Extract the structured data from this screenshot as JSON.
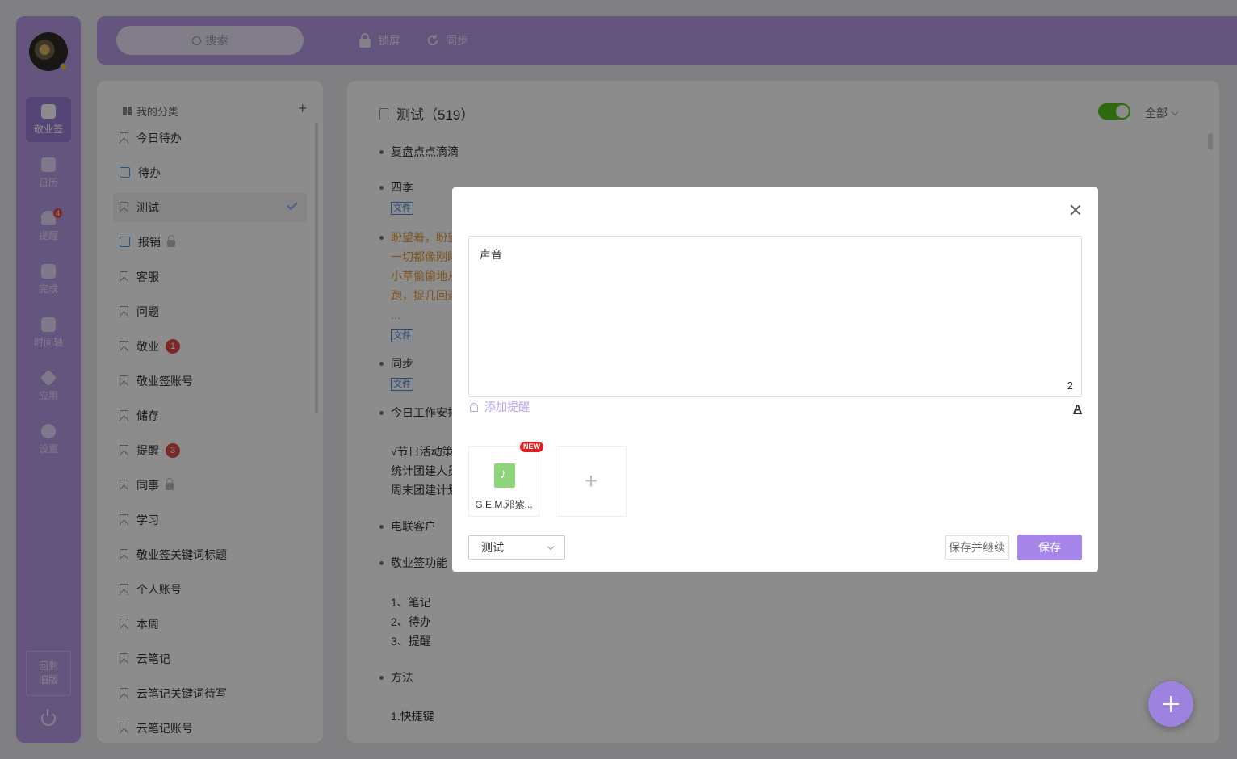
{
  "rail": {
    "items": [
      {
        "label": "敬业签",
        "icon": "cloud-note-icon"
      },
      {
        "label": "日历",
        "icon": "calendar-icon"
      },
      {
        "label": "提醒",
        "icon": "bell-icon",
        "badge": "4"
      },
      {
        "label": "完成",
        "icon": "clipboard-check-icon"
      },
      {
        "label": "时间轴",
        "icon": "timeline-icon"
      },
      {
        "label": "应用",
        "icon": "cube-icon"
      },
      {
        "label": "设置",
        "icon": "gear-icon"
      }
    ],
    "old_version_line1": "回到",
    "old_version_line2": "旧版"
  },
  "topbar": {
    "search_placeholder": "搜索",
    "lock_label": "锁屏",
    "sync_label": "同步"
  },
  "categories": {
    "header": "我的分类",
    "items": [
      {
        "label": "今日待办"
      },
      {
        "label": "待办"
      },
      {
        "label": "测试"
      },
      {
        "label": "报销"
      },
      {
        "label": "客服"
      },
      {
        "label": "问题"
      },
      {
        "label": "敬业",
        "count": "1"
      },
      {
        "label": "敬业签账号"
      },
      {
        "label": "储存"
      },
      {
        "label": "提醒",
        "count": "3"
      },
      {
        "label": "同事"
      },
      {
        "label": "学习"
      },
      {
        "label": "敬业签关键词标题"
      },
      {
        "label": "个人账号"
      },
      {
        "label": "本周"
      },
      {
        "label": "云笔记"
      },
      {
        "label": "云笔记关键词待写"
      },
      {
        "label": "云笔记账号"
      }
    ]
  },
  "notes": {
    "title": "测试（519）",
    "filter": "全部",
    "file_tag": "文件",
    "items": [
      "复盘点点滴滴",
      "四季",
      "盼望着，盼望",
      "一切都像刚睡",
      "小草偷偷地从",
      "跑，捉几回迷",
      "...",
      "同步",
      "今日工作安排",
      "√节日活动策",
      "统计团建人员",
      "周末团建计划",
      "电联客户",
      "敬业签功能",
      "1、笔记",
      "2、待办",
      "3、提醒",
      "方法",
      "1.快捷键"
    ]
  },
  "dialog": {
    "content": "声音",
    "word_count": "2",
    "add_reminder": "添加提醒",
    "font_icon_label": "A",
    "attachment_name": "G.E.M.邓紫...",
    "new_badge": "NEW",
    "category_value": "测试",
    "save_continue": "保存并继续",
    "save": "保存"
  },
  "colors": {
    "accent": "#b49be6",
    "primary_button": "#a686e8",
    "badge_red": "#e04a4a",
    "toggle_green": "#52c41a"
  }
}
